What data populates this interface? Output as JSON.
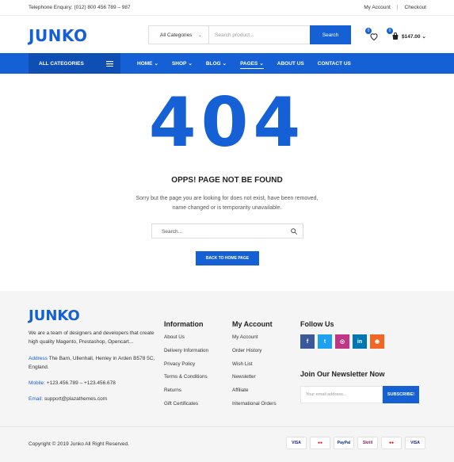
{
  "topbar": {
    "phone": "Telephone Enquiry: (012) 800 456 789 – 987",
    "my_account": "My Account",
    "separator": "|",
    "checkout": "Checkout"
  },
  "header": {
    "logo": "JUNKO",
    "search_category": "All Categories",
    "search_placeholder": "Search product...",
    "search_button": "Search",
    "wishlist_count": "0",
    "cart_count": "0",
    "cart_total": "$147.00"
  },
  "nav": {
    "all_categories": "ALL CATEGORIES",
    "items": [
      {
        "label": "HOME",
        "chevron": "⌄"
      },
      {
        "label": "SHOP",
        "chevron": "⌄"
      },
      {
        "label": "BLOG",
        "chevron": "⌄"
      },
      {
        "label": "PAGES",
        "chevron": "⌄"
      },
      {
        "label": "ABOUT US",
        "chevron": ""
      },
      {
        "label": "CONTACT US",
        "chevron": ""
      }
    ],
    "active": "PAGES"
  },
  "notfound": {
    "code": "404",
    "heading": "OPPS! PAGE NOT BE FOUND",
    "message": "Sorry but the page you are looking for does not exist, have been removed, name changed or is temporarity unavailable.",
    "search_placeholder": "Search...",
    "back_button": "BACK TO HOME PAGE"
  },
  "footer": {
    "logo": "JUNKO",
    "description": "We are a team of designers and developers that create high quality Magento, Prestashop, Opencart...",
    "address_label": "Address",
    "address": "The Barn, Ullenhall, Henley in Arden B578 5C, England.",
    "mobile_label": "Mobile:",
    "mobile": "+123.456.789 – +123.456.678",
    "email_label": "Email:",
    "email": "support@plazathemes.com",
    "information": {
      "title": "Information",
      "links": [
        "About Us",
        "Delivery Information",
        "Privacy Policy",
        "Terms & Conditions",
        "Returns",
        "Gift Certificates"
      ]
    },
    "my_account": {
      "title": "My Account",
      "links": [
        "My Account",
        "Order History",
        "Wish List",
        "Newsletter",
        "Affiliate",
        "International Orders"
      ]
    },
    "follow": {
      "title": "Follow Us",
      "socials": [
        {
          "name": "facebook-icon",
          "glyph": "f",
          "color": "#3b5998"
        },
        {
          "name": "twitter-icon",
          "glyph": "t",
          "color": "#1da1f2"
        },
        {
          "name": "instagram-icon",
          "glyph": "◎",
          "color": "#c13584"
        },
        {
          "name": "linkedin-icon",
          "glyph": "in",
          "color": "#0077b5"
        },
        {
          "name": "rss-icon",
          "glyph": "◉",
          "color": "#f26522"
        }
      ]
    },
    "newsletter": {
      "title": "Join Our Newsletter Now",
      "placeholder": "Your email address...",
      "button": "SUBSCRIBE!"
    },
    "copyright": "Copyright © 2019 Junko All Right Reserved.",
    "payments": [
      {
        "label": "VISA",
        "color": "#1a1f71"
      },
      {
        "label": "●●",
        "color": "#eb001b"
      },
      {
        "label": "PayPal",
        "color": "#003087"
      },
      {
        "label": "Skrill",
        "color": "#862165"
      },
      {
        "label": "●●",
        "color": "#cc0000"
      },
      {
        "label": "VISA",
        "color": "#1a1f71"
      }
    ]
  },
  "colors": {
    "accent": "#1560d4"
  }
}
